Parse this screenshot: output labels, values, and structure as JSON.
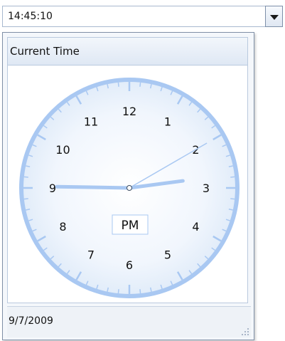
{
  "time_input": {
    "value": "14:45:10"
  },
  "popup": {
    "title": "Current Time",
    "am_pm": "PM",
    "date": "9/7/2009",
    "clock_numbers": [
      "12",
      "1",
      "2",
      "3",
      "4",
      "5",
      "6",
      "7",
      "8",
      "9",
      "10",
      "11"
    ]
  },
  "clock_time": {
    "hours": 14,
    "minutes": 45,
    "seconds": 10
  },
  "colors": {
    "clock_ring": "#a9c8f2",
    "clock_face_center": "#ffffff",
    "clock_face_edge": "#e1ecf9",
    "hand": "#a9c8f2",
    "numeral": "#111111"
  },
  "icons": {
    "dropdown": "chevron-down-icon",
    "resize": "resize-grip-icon"
  }
}
